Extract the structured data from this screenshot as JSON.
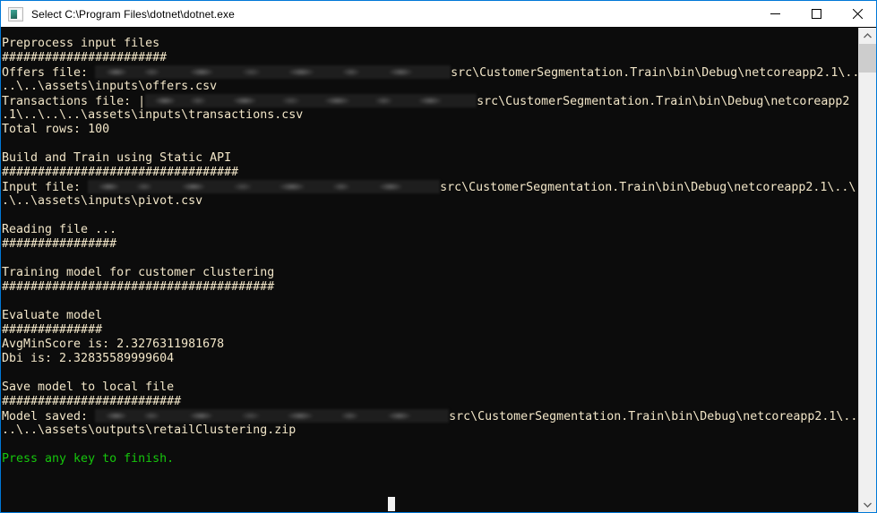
{
  "window": {
    "title": "Select C:\\Program Files\\dotnet\\dotnet.exe",
    "icon": "console-app-icon",
    "accent_color": "#0078d7",
    "background_color": "#0c0c0c",
    "text_color": "#f2e6c8",
    "highlight_color": "#16c60c"
  },
  "titlebar": {
    "minimize_label": "–",
    "maximize_label": "□",
    "close_label": "✕"
  },
  "scrollbar": {
    "up_arrow": "▲",
    "down_arrow": "▼"
  },
  "console": {
    "lines": [
      {
        "id": "l01",
        "text": "Preprocess input files"
      },
      {
        "id": "l02",
        "text": "#######################"
      },
      {
        "id": "l03",
        "pre": "Offers file: ",
        "redact_width": 397,
        "post": "src\\CustomerSegmentation.Train\\bin\\Debug\\netcoreapp2.1\\..\\"
      },
      {
        "id": "l04",
        "text": "..\\..\\assets\\inputs\\offers.csv"
      },
      {
        "id": "l05",
        "pre": "Transactions file: |",
        "redact_width": 370,
        "post": "src\\CustomerSegmentation.Train\\bin\\Debug\\netcoreapp2"
      },
      {
        "id": "l06",
        "text": ".1\\..\\..\\..\\assets\\inputs\\transactions.csv"
      },
      {
        "id": "l07",
        "text": "Total rows: 100"
      },
      {
        "id": "l08",
        "text": ""
      },
      {
        "id": "l09",
        "text": "Build and Train using Static API"
      },
      {
        "id": "l10",
        "text": "#################################"
      },
      {
        "id": "l11",
        "pre": "Input file: ",
        "redact_width": 393,
        "post": "src\\CustomerSegmentation.Train\\bin\\Debug\\netcoreapp2.1\\..\\."
      },
      {
        "id": "l12",
        "text": ".\\..\\assets\\inputs\\pivot.csv"
      },
      {
        "id": "l13",
        "text": ""
      },
      {
        "id": "l14",
        "text": "Reading file ..."
      },
      {
        "id": "l15",
        "text": "################"
      },
      {
        "id": "l16",
        "text": ""
      },
      {
        "id": "l17",
        "text": "Training model for customer clustering"
      },
      {
        "id": "l18",
        "text": "######################################"
      },
      {
        "id": "l19",
        "text": ""
      },
      {
        "id": "l20",
        "text": "Evaluate model"
      },
      {
        "id": "l21",
        "text": "##############"
      },
      {
        "id": "l22",
        "text": "AvgMinScore is: 2.3276311981678"
      },
      {
        "id": "l23",
        "text": "Dbi is: 2.32835589999604"
      },
      {
        "id": "l24",
        "text": ""
      },
      {
        "id": "l25",
        "text": "Save model to local file"
      },
      {
        "id": "l26",
        "text": "#########################"
      },
      {
        "id": "l27",
        "pre": "Model saved: ",
        "redact_width": 395,
        "post": "src\\CustomerSegmentation.Train\\bin\\Debug\\netcoreapp2.1\\..\\"
      },
      {
        "id": "l28",
        "text": "..\\..\\assets\\outputs\\retailClustering.zip"
      },
      {
        "id": "l29",
        "text": ""
      },
      {
        "id": "l30",
        "text": "Press any key to finish.",
        "color": "green"
      }
    ]
  }
}
